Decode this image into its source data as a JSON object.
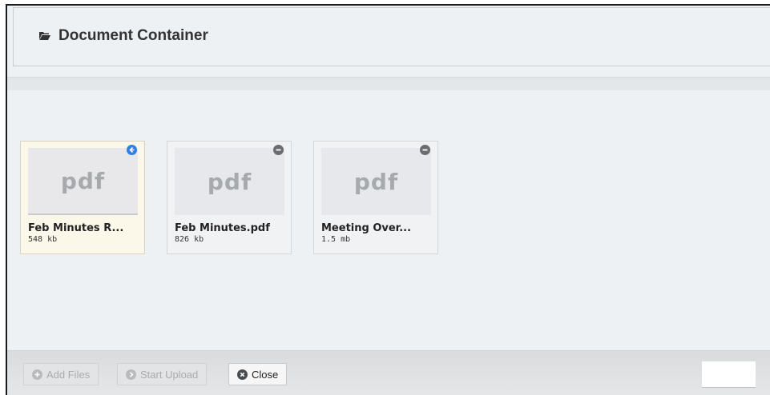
{
  "header": {
    "title": "Document Container",
    "icon": "folder-open-icon"
  },
  "files": [
    {
      "thumb_label": "pdf",
      "name": "Feb Minutes R...",
      "size": "548 kb",
      "status_icon": "upload-arrow-icon",
      "status_color": "#2f7fe0",
      "selected": true
    },
    {
      "thumb_label": "pdf",
      "name": "Feb Minutes.pdf",
      "size": "826 kb",
      "status_icon": "remove-icon",
      "status_color": "#6a6d70",
      "selected": false
    },
    {
      "thumb_label": "pdf",
      "name": "Meeting Over...",
      "size": "1.5 mb",
      "status_icon": "remove-icon",
      "status_color": "#6a6d70",
      "selected": false
    }
  ],
  "footer": {
    "add_files_label": "Add Files",
    "start_upload_label": "Start Upload",
    "close_label": "Close"
  }
}
